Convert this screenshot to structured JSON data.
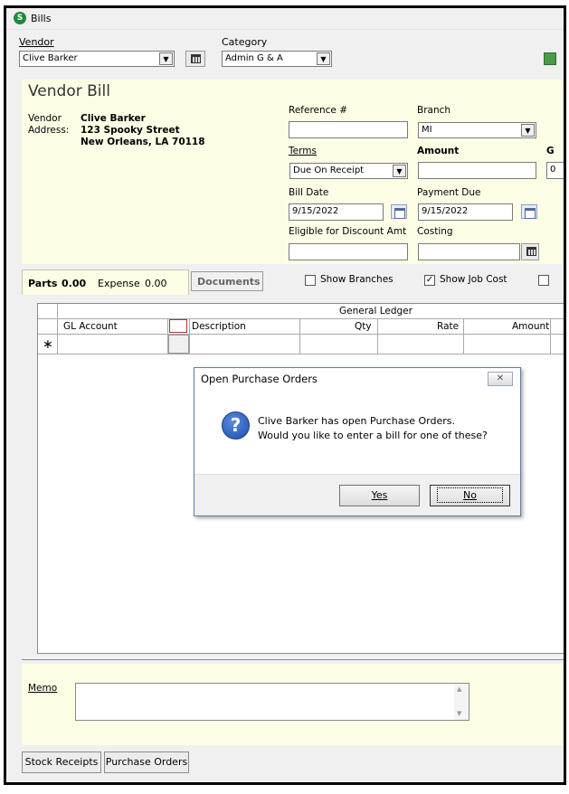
{
  "window": {
    "title": "Bills",
    "app_icon": "S"
  },
  "header": {
    "vendor_label": "Vendor",
    "vendor_value": "Clive Barker",
    "category_label": "Category",
    "category_value": "Admin G & A"
  },
  "bill": {
    "title": "Vendor Bill",
    "vendor_label": "Vendor",
    "address_label": "Address:",
    "vendor_name": "Clive Barker",
    "address_line1": "123 Spooky Street",
    "address_line2": "New Orleans, LA  70118",
    "reference_label": "Reference #",
    "reference_value": "",
    "branch_label": "Branch",
    "branch_value": "MI",
    "terms_label": "Terms",
    "terms_value": "Due On Receipt",
    "amount_label": "Amount",
    "amount_value": "",
    "cut_label": "G",
    "cut_value": "0",
    "bill_date_label": "Bill Date",
    "bill_date_value": "9/15/2022",
    "payment_due_label": "Payment Due",
    "payment_due_value": "9/15/2022",
    "discount_label": "Eligible for Discount Amt",
    "discount_value": "",
    "costing_label": "Costing",
    "costing_value": ""
  },
  "tabs": [
    {
      "label": "Parts",
      "value": "0.00"
    },
    {
      "label": "Expense",
      "value": "0.00"
    },
    {
      "label": "Documents",
      "value": ""
    }
  ],
  "options": {
    "show_branches_label": "Show Branches",
    "show_branches_checked": false,
    "show_job_cost_label": "Show Job Cost",
    "show_job_cost_checked": true
  },
  "grid": {
    "group_header": "General Ledger",
    "columns": [
      "GL Account",
      "Description",
      "Qty",
      "Rate",
      "Amount"
    ],
    "new_row_marker": "∗"
  },
  "dialog": {
    "title": "Open Purchase Orders",
    "message_line1": "Clive Barker has open Purchase Orders.",
    "message_line2": "Would you like to enter a bill for one of these?",
    "yes_label": "Yes",
    "no_label": "No"
  },
  "memo": {
    "label": "Memo",
    "value": ""
  },
  "footer": {
    "stock_receipts_label": "Stock Receipts",
    "purchase_orders_label": "Purchase Orders"
  }
}
